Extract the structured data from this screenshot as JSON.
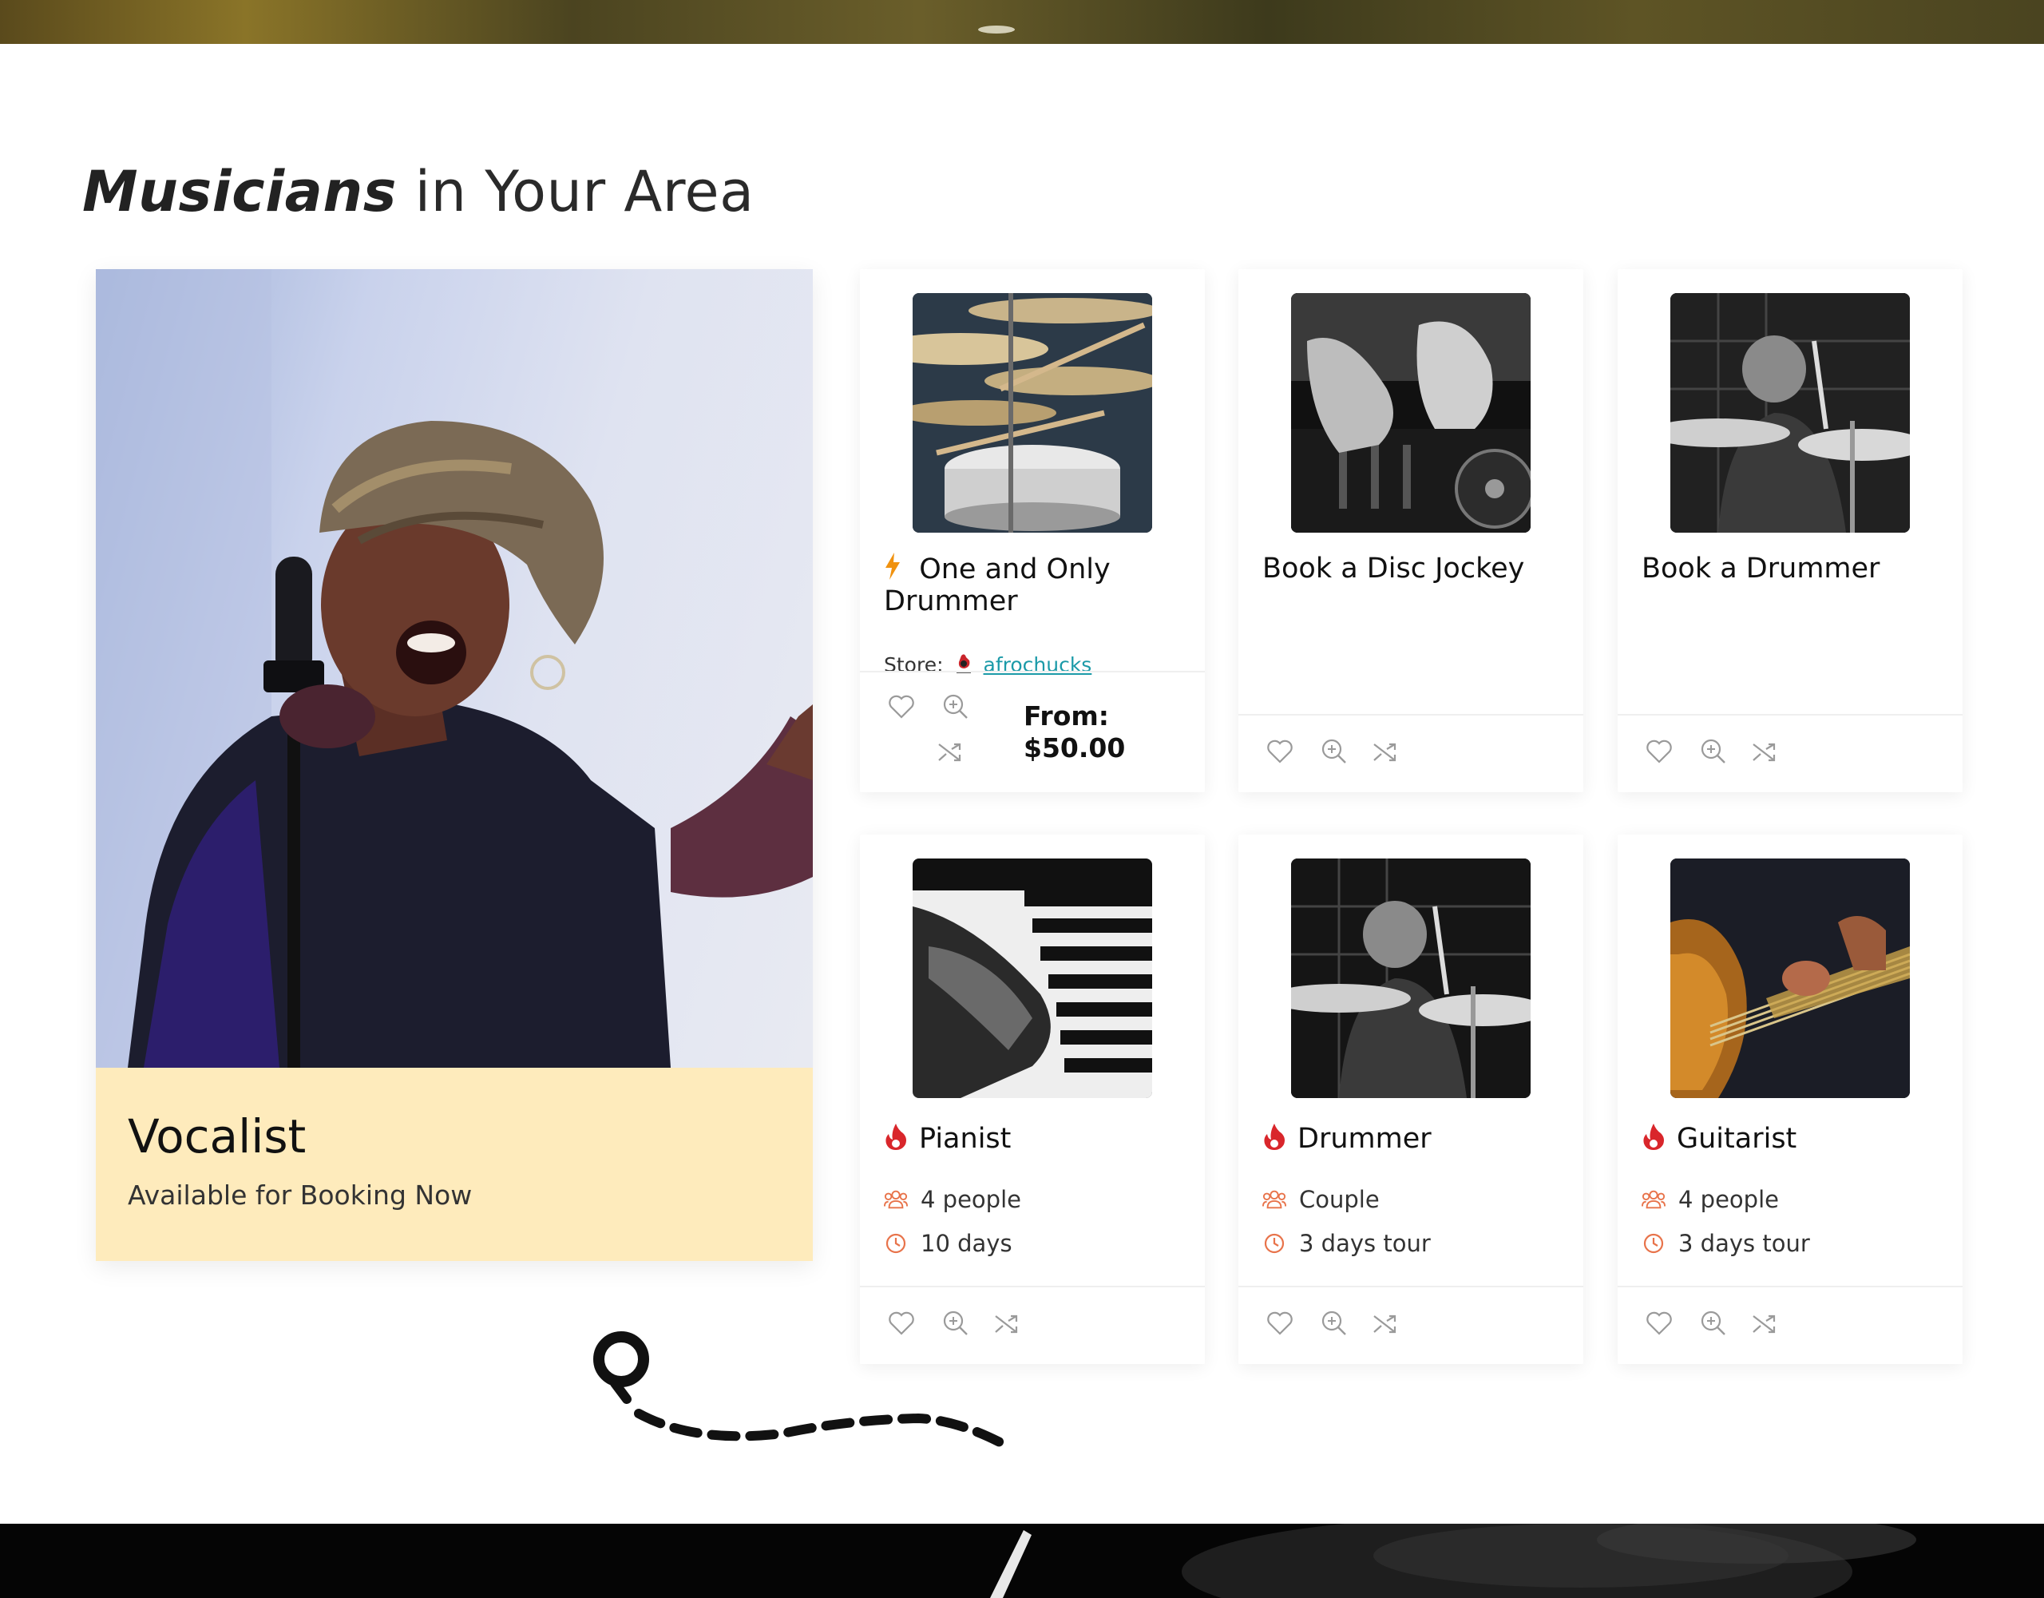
{
  "section": {
    "title_bold": "Musicians",
    "title_rest": " in Your Area"
  },
  "feature": {
    "title": "Vocalist",
    "subtitle": "Available for Booking Now"
  },
  "cards": [
    {
      "title": "One and Only Drummer",
      "store_label": "Store:",
      "store_name": "afrochucks",
      "price_label": "From:",
      "price": "$50.00"
    },
    {
      "title": "Book a Disc Jockey"
    },
    {
      "title": "Book a Drummer"
    },
    {
      "title": "Pianist",
      "people": "4 people",
      "duration": "10 days"
    },
    {
      "title": "Drummer",
      "people": "Couple",
      "duration": "3 days tour"
    },
    {
      "title": "Guitarist",
      "people": "4 people",
      "duration": "3 days tour"
    }
  ],
  "colors": {
    "accent_fire": "#d9262b",
    "accent_meta": "#e8734a",
    "flash": "#f0920f",
    "caption_bg": "#feebbc",
    "store_link": "#1b9aa8"
  },
  "icons": [
    "heart-icon",
    "zoom-in-icon",
    "shuffle-icon",
    "lightning-icon",
    "fire-icon",
    "people-icon",
    "clock-icon",
    "map-pin-icon"
  ]
}
